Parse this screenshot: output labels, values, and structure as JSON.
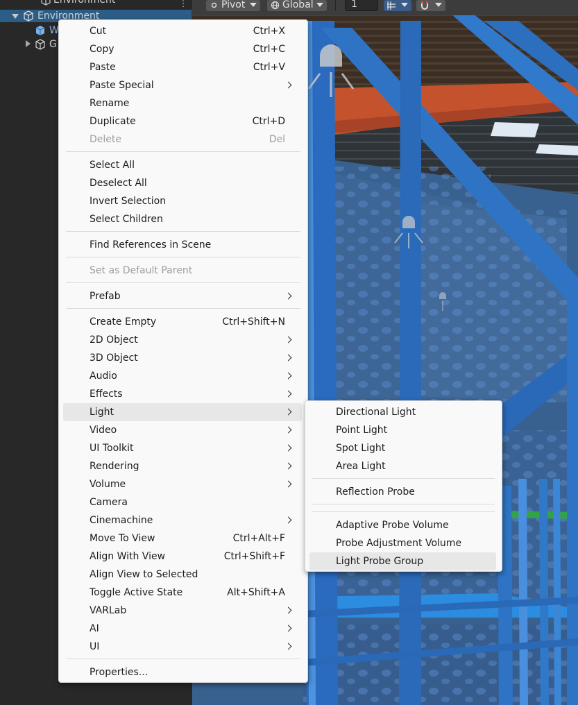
{
  "hierarchy": {
    "top_item": "Environment",
    "selected_item": "Environment",
    "child_w": "W",
    "child_g": "G"
  },
  "toolbar": {
    "pivot": "Pivot",
    "global": "Global",
    "grid_value": "1"
  },
  "context_menu": {
    "items": [
      {
        "label": "Cut",
        "shortcut": "Ctrl+X"
      },
      {
        "label": "Copy",
        "shortcut": "Ctrl+C"
      },
      {
        "label": "Paste",
        "shortcut": "Ctrl+V"
      },
      {
        "label": "Paste Special",
        "shortcut": ""
      },
      {
        "label": "Rename",
        "shortcut": ""
      },
      {
        "label": "Duplicate",
        "shortcut": "Ctrl+D"
      },
      {
        "label": "Delete",
        "shortcut": "Del"
      },
      {
        "label": "Select All",
        "shortcut": ""
      },
      {
        "label": "Deselect All",
        "shortcut": ""
      },
      {
        "label": "Invert Selection",
        "shortcut": ""
      },
      {
        "label": "Select Children",
        "shortcut": ""
      },
      {
        "label": "Find References in Scene",
        "shortcut": ""
      },
      {
        "label": "Set as Default Parent",
        "shortcut": ""
      },
      {
        "label": "Prefab",
        "shortcut": ""
      },
      {
        "label": "Create Empty",
        "shortcut": "Ctrl+Shift+N"
      },
      {
        "label": "2D Object",
        "shortcut": ""
      },
      {
        "label": "3D Object",
        "shortcut": ""
      },
      {
        "label": "Audio",
        "shortcut": ""
      },
      {
        "label": "Effects",
        "shortcut": ""
      },
      {
        "label": "Light",
        "shortcut": ""
      },
      {
        "label": "Video",
        "shortcut": ""
      },
      {
        "label": "UI Toolkit",
        "shortcut": ""
      },
      {
        "label": "Rendering",
        "shortcut": ""
      },
      {
        "label": "Volume",
        "shortcut": ""
      },
      {
        "label": "Camera",
        "shortcut": ""
      },
      {
        "label": "Cinemachine",
        "shortcut": ""
      },
      {
        "label": "Move To View",
        "shortcut": "Ctrl+Alt+F"
      },
      {
        "label": "Align With View",
        "shortcut": "Ctrl+Shift+F"
      },
      {
        "label": "Align View to Selected",
        "shortcut": ""
      },
      {
        "label": "Toggle Active State",
        "shortcut": "Alt+Shift+A"
      },
      {
        "label": "VARLab",
        "shortcut": ""
      },
      {
        "label": "AI",
        "shortcut": ""
      },
      {
        "label": "UI",
        "shortcut": ""
      },
      {
        "label": "Properties...",
        "shortcut": ""
      }
    ]
  },
  "light_submenu": {
    "items": [
      {
        "label": "Directional Light"
      },
      {
        "label": "Point Light"
      },
      {
        "label": "Spot Light"
      },
      {
        "label": "Area Light"
      },
      {
        "label": "Reflection Probe"
      },
      {
        "label": "Adaptive Probe Volume"
      },
      {
        "label": "Probe Adjustment Volume"
      },
      {
        "label": "Light Probe Group"
      }
    ]
  },
  "colors": {
    "hierarchy_bg": "#282828",
    "selection": "#2c5d87",
    "menu_bg": "#f9f9f9",
    "menu_highlight": "#e7e7e7",
    "disabled_text": "#9d9d9d",
    "rack_blue": "#2f74c4",
    "beam_orange": "#c4532d"
  }
}
